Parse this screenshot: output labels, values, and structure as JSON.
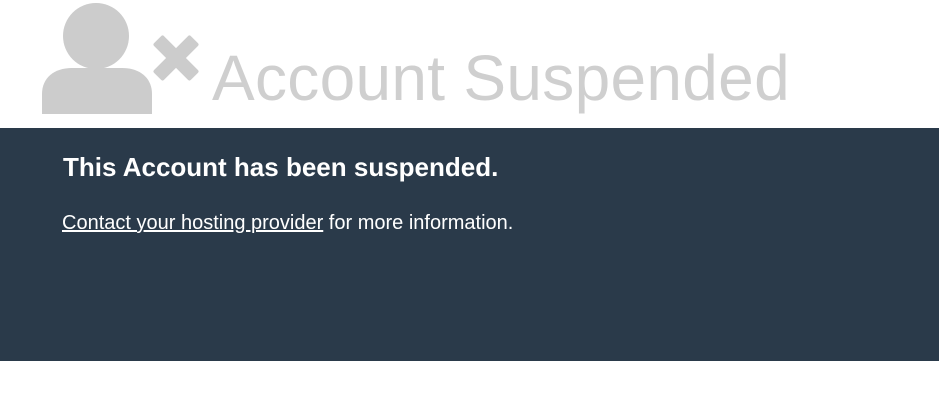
{
  "header": {
    "icon": "user-suspended-icon",
    "title": "Account Suspended"
  },
  "notice": {
    "heading": "This Account has been suspended.",
    "contact_link": "Contact your hosting provider",
    "message_suffix": " for more information."
  },
  "colors": {
    "band_background": "#2a3a4a",
    "header_text": "#cfcfcf",
    "icon_fill": "#cccccc",
    "band_text": "#ffffff"
  }
}
